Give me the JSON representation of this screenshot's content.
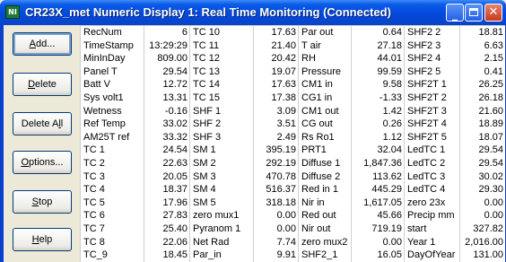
{
  "window": {
    "title": "CR23X_met Numeric Display 1: Real Time Monitoring (Connected)",
    "app_icon_text": "NI",
    "minimize_glyph": "_",
    "close_glyph": "✕"
  },
  "buttons": [
    {
      "prefix": "",
      "ul": "A",
      "suffix": "dd...",
      "name": "add-button"
    },
    {
      "prefix": "",
      "ul": "D",
      "suffix": "elete",
      "name": "delete-button"
    },
    {
      "prefix": "Delete A",
      "ul": "l",
      "suffix": "l",
      "name": "delete-all-button"
    },
    {
      "prefix": "",
      "ul": "O",
      "suffix": "ptions...",
      "name": "options-button"
    },
    {
      "prefix": "",
      "ul": "S",
      "suffix": "top",
      "name": "stop-button"
    },
    {
      "prefix": "",
      "ul": "H",
      "suffix": "elp",
      "name": "help-button"
    }
  ],
  "columns": [
    [
      {
        "label": "RecNum",
        "value": "6"
      },
      {
        "label": "TimeStamp",
        "value": "13:29:29"
      },
      {
        "label": "MinInDay",
        "value": "809.00"
      },
      {
        "label": "Panel  T",
        "value": "29.54"
      },
      {
        "label": "Batt  V",
        "value": "12.72"
      },
      {
        "label": "Sys  volt1",
        "value": "13.31"
      },
      {
        "label": "Wetness",
        "value": "-0.16"
      },
      {
        "label": "Ref Temp",
        "value": "33.02"
      },
      {
        "label": "AM25T  ref",
        "value": "33.32"
      },
      {
        "label": "TC  1",
        "value": "24.54"
      },
      {
        "label": "TC  2",
        "value": "22.63"
      },
      {
        "label": "TC  3",
        "value": "20.05"
      },
      {
        "label": "TC  4",
        "value": "18.37"
      },
      {
        "label": "TC  5",
        "value": "17.96"
      },
      {
        "label": "TC  6",
        "value": "27.83"
      },
      {
        "label": "TC  7",
        "value": "25.40"
      },
      {
        "label": "TC  8",
        "value": "22.06"
      },
      {
        "label": "TC_9",
        "value": "18.45"
      }
    ],
    [
      {
        "label": "TC  10",
        "value": "17.63"
      },
      {
        "label": "TC  11",
        "value": "21.40"
      },
      {
        "label": "TC  12",
        "value": "20.42"
      },
      {
        "label": "TC  13",
        "value": "19.07"
      },
      {
        "label": "TC  14",
        "value": "17.63"
      },
      {
        "label": "TC  15",
        "value": "17.38"
      },
      {
        "label": "SHF    1",
        "value": "3.09"
      },
      {
        "label": "SHF    2",
        "value": "3.51"
      },
      {
        "label": "SHF    3",
        "value": "2.49"
      },
      {
        "label": "SM  1",
        "value": "395.19"
      },
      {
        "label": "SM  2",
        "value": "292.19"
      },
      {
        "label": "SM  3",
        "value": "470.78"
      },
      {
        "label": "SM  4",
        "value": "516.37"
      },
      {
        "label": "SM  5",
        "value": "318.18"
      },
      {
        "label": "zero  mux1",
        "value": "0.00"
      },
      {
        "label": "Pyranom  1",
        "value": "0.00"
      },
      {
        "label": "Net  Rad",
        "value": "7.74"
      },
      {
        "label": "Par_in",
        "value": "9.91"
      }
    ],
    [
      {
        "label": "Par  out",
        "value": "0.64"
      },
      {
        "label": "T  air",
        "value": "27.18"
      },
      {
        "label": "RH",
        "value": "44.01"
      },
      {
        "label": "Pressure",
        "value": "99.59"
      },
      {
        "label": "CM1  in",
        "value": "9.58"
      },
      {
        "label": "CG1  in",
        "value": "-1.33"
      },
      {
        "label": "CM1  out",
        "value": "1.42"
      },
      {
        "label": "CG  out",
        "value": "0.26"
      },
      {
        "label": "Rs  Ro1",
        "value": "1.12"
      },
      {
        "label": "PRT1",
        "value": "32.04"
      },
      {
        "label": "Diffuse  1",
        "value": "1,847.36"
      },
      {
        "label": "Diffuse  2",
        "value": "113.62"
      },
      {
        "label": "Red  in  1",
        "value": "445.29"
      },
      {
        "label": "Nir  in",
        "value": "1,617.05"
      },
      {
        "label": "Red  out",
        "value": "45.66"
      },
      {
        "label": "Nir  out",
        "value": "719.19"
      },
      {
        "label": "zero  mux2",
        "value": "0.00"
      },
      {
        "label": "SHF2_1",
        "value": "16.05"
      }
    ],
    [
      {
        "label": "SHF2  2",
        "value": "18.81"
      },
      {
        "label": "SHF2  3",
        "value": "6.63"
      },
      {
        "label": "SHF2  4",
        "value": "2.15"
      },
      {
        "label": "SHF2  5",
        "value": "0.41"
      },
      {
        "label": "SHF2T  1",
        "value": "26.25"
      },
      {
        "label": "SHF2T  2",
        "value": "26.18"
      },
      {
        "label": "SHF2T  3",
        "value": "21.60"
      },
      {
        "label": "SHF2T  4",
        "value": "18.89"
      },
      {
        "label": "SHF2T  5",
        "value": "18.07"
      },
      {
        "label": "LedTC  1",
        "value": "29.54"
      },
      {
        "label": "LedTC  2",
        "value": "29.54"
      },
      {
        "label": "LedTC  3",
        "value": "30.02"
      },
      {
        "label": "LedTC  4",
        "value": "29.30"
      },
      {
        "label": "zero  23x",
        "value": "0.00"
      },
      {
        "label": "Precip  mm",
        "value": "0.00"
      },
      {
        "label": "start",
        "value": "327.82"
      },
      {
        "label": "Year  1",
        "value": "2,016.00"
      },
      {
        "label": "DayOfYear",
        "value": "131.00"
      }
    ]
  ]
}
